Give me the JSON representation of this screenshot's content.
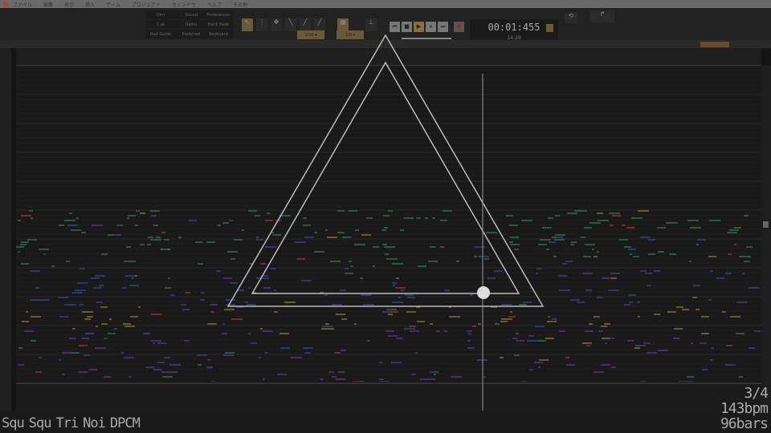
{
  "menu": {
    "items": [
      "ファイル",
      "編集",
      "表示",
      "挿入",
      "ゲーム",
      "プロジェクト",
      "ウィンドウ",
      "ヘルプ",
      "その他"
    ]
  },
  "toolbar": {
    "buttons": [
      "Dim",
      "Sound",
      "Preferences",
      "Cue",
      "Radio",
      "Bank Fade",
      "Bad Guide",
      "Preferred",
      "Keyboard"
    ],
    "tools": [
      "Select",
      "Delete",
      "Move",
      "Pen",
      "Draw",
      "Smear"
    ],
    "transport": [
      "rewind",
      "stop",
      "play",
      "pause",
      "forward",
      "record"
    ],
    "time": "00:01:455",
    "tempo_readout": "14:28",
    "snap": "1/16 ▾",
    "grid": "1/8 ▾"
  },
  "overlay": {
    "channels": [
      "Squ",
      "Squ",
      "Tri",
      "Noi",
      "DPCM"
    ],
    "time_signature": "3/4",
    "tempo": "143bpm",
    "length": "96bars"
  },
  "colors": {
    "accent": "#8a6e3c",
    "note_red": "#7a2a2a",
    "note_green": "#2a5a3a",
    "note_blue": "#2a3a6a",
    "note_yellow": "#6a5a2a",
    "note_purple": "#4a2a6a"
  }
}
